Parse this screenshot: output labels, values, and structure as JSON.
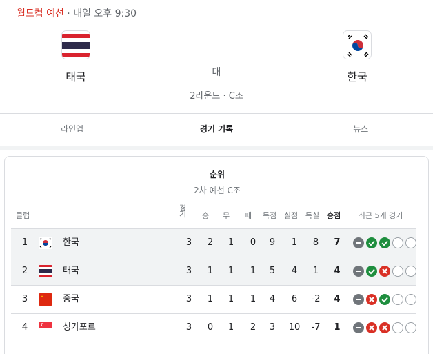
{
  "header": {
    "competition": "월드컵 예선",
    "separator": " · ",
    "time": "내일 오후 9:30"
  },
  "match": {
    "home": "태국",
    "away": "한국",
    "vs": "대",
    "round": "2라운드 · C조"
  },
  "tabs": [
    {
      "label": "라인업"
    },
    {
      "label": "경기 기록"
    },
    {
      "label": "뉴스"
    }
  ],
  "standings": {
    "title": "순위",
    "subtitle": "2차 예선 C조",
    "headers": {
      "club": "클럽",
      "played": "경기",
      "won": "승",
      "drawn": "무",
      "lost": "패",
      "gf": "득점",
      "ga": "실점",
      "gd": "득실",
      "pts": "승점",
      "form": "최근 5개 경기"
    },
    "rows": [
      {
        "rank": "1",
        "team": "한국",
        "flag": "korea",
        "played": "3",
        "won": "2",
        "drawn": "1",
        "lost": "0",
        "gf": "9",
        "ga": "1",
        "gd": "8",
        "pts": "7",
        "form": [
          "draw",
          "win",
          "win",
          "none",
          "none"
        ]
      },
      {
        "rank": "2",
        "team": "태국",
        "flag": "thailand",
        "played": "3",
        "won": "1",
        "drawn": "1",
        "lost": "1",
        "gf": "5",
        "ga": "4",
        "gd": "1",
        "pts": "4",
        "form": [
          "draw",
          "win",
          "loss",
          "none",
          "none"
        ]
      },
      {
        "rank": "3",
        "team": "중국",
        "flag": "china",
        "played": "3",
        "won": "1",
        "drawn": "1",
        "lost": "1",
        "gf": "4",
        "ga": "6",
        "gd": "-2",
        "pts": "4",
        "form": [
          "draw",
          "loss",
          "win",
          "none",
          "none"
        ]
      },
      {
        "rank": "4",
        "team": "싱가포르",
        "flag": "singapore",
        "played": "3",
        "won": "0",
        "drawn": "1",
        "lost": "2",
        "gf": "3",
        "ga": "10",
        "gd": "-7",
        "pts": "1",
        "form": [
          "draw",
          "loss",
          "loss",
          "none",
          "none"
        ]
      }
    ]
  },
  "colors": {
    "win": "#1e8e3e",
    "loss": "#d93025",
    "draw": "#70757a",
    "accent_red": "#d93025"
  }
}
